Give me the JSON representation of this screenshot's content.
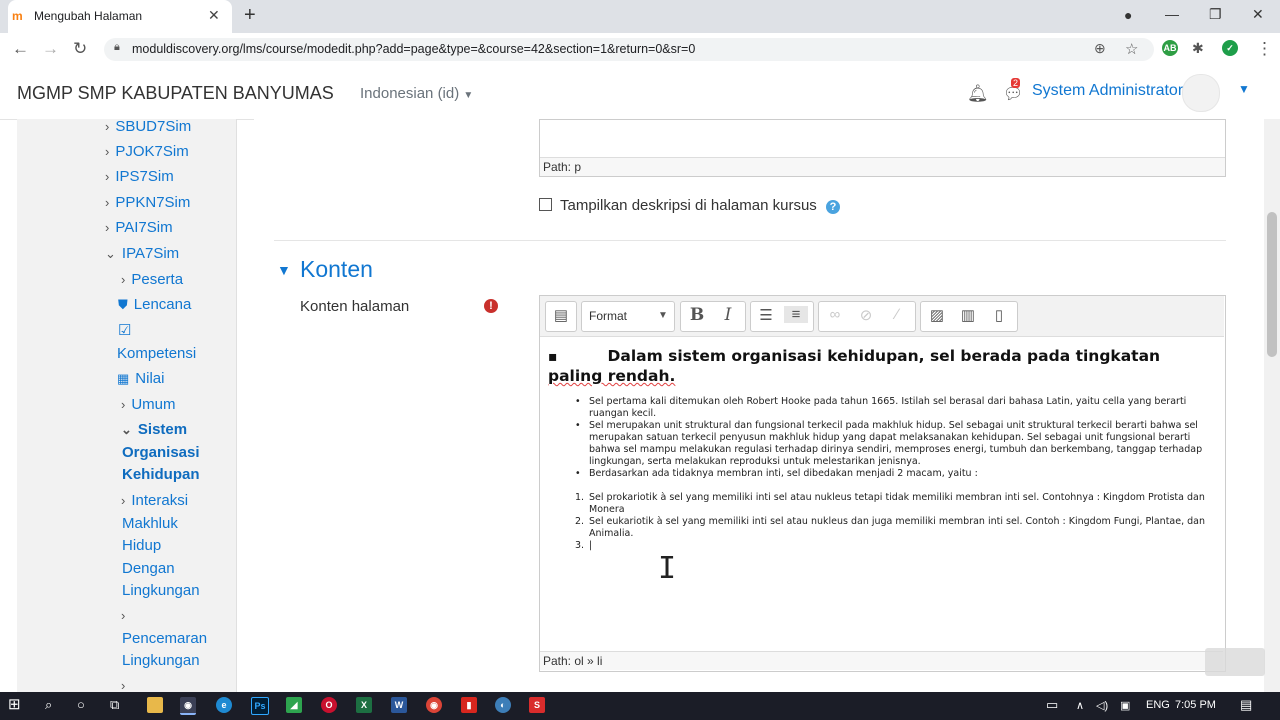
{
  "browser": {
    "tab_title": "Mengubah Halaman",
    "tab_close": "✕",
    "new_tab": "+",
    "url": "moduldiscovery.org/lms/course/modedit.php?add=page&type=&course=42&section=1&return=0&sr=0"
  },
  "navbar": {
    "site_name": "MGMP SMP KABUPATEN BANYUMAS",
    "language": "Indonesian (id)",
    "message_count": "2",
    "user_name": "System Administrator"
  },
  "drawer": {
    "items": [
      {
        "label": "SBUD7Sim"
      },
      {
        "label": "PJOK7Sim"
      },
      {
        "label": "IPS7Sim"
      },
      {
        "label": "PPKN7Sim"
      },
      {
        "label": "PAI7Sim"
      },
      {
        "label": "IPA7Sim"
      }
    ],
    "sub": {
      "peserta": "Peserta",
      "lencana": "Lencana",
      "kompetensi": "Kompetensi",
      "nilai": "Nilai",
      "umum": "Umum",
      "sistem_1": "Sistem",
      "sistem_2": "Organisasi",
      "sistem_3": "Kehidupan",
      "interaksi_1": "Interaksi",
      "interaksi_2": "Makhluk",
      "interaksi_3": "Hidup",
      "interaksi_4": "Dengan",
      "interaksi_5": "Lingkungan",
      "pencemaran_1": "Pencemaran",
      "pencemaran_2": "Lingkungan"
    }
  },
  "form": {
    "desc_path": "Path: p",
    "show_desc_label": "Tampilkan deskripsi di halaman kursus",
    "section_title": "Konten",
    "content_label": "Konten halaman",
    "format_label": "Format",
    "content_path": "Path: ol » li"
  },
  "editor": {
    "heading_prefix": "Dalam sistem organisasi kehidupan, sel berada pada tingkatan",
    "heading_suffix": "paling rendah.",
    "bullets": [
      "Sel pertama kali ditemukan oleh Robert Hooke pada tahun 1665. Istilah sel berasal dari bahasa Latin, yaitu cella yang berarti ruangan kecil.",
      "Sel merupakan unit struktural dan fungsional terkecil pada makhluk hidup. Sel sebagai unit struktural terkecil berarti bahwa sel merupakan satuan terkecil penyusun makhluk hidup yang dapat melaksanakan kehidupan. Sel sebagai unit fungsional berarti bahwa sel mampu melakukan regulasi terhadap dirinya sendiri, memproses energi, tumbuh dan berkembang, tanggap terhadap lingkungan, serta melakukan reproduksi untuk melestarikan jenisnya.",
      "Berdasarkan ada tidaknya membran inti, sel dibedakan menjadi 2 macam, yaitu :"
    ],
    "ordered": [
      "Sel prokariotik à sel yang memiliki inti sel atau nukleus tetapi tidak memiliki membran inti sel. Contohnya : Kingdom Protista dan Monera",
      "Sel eukariotik à sel yang memiliki inti sel atau nukleus dan juga memiliki membran inti sel. Contoh : Kingdom Fungi, Plantae, dan Animalia.",
      "|"
    ]
  },
  "taskbar": {
    "lang": "ENG",
    "time": "7:05 PM"
  }
}
